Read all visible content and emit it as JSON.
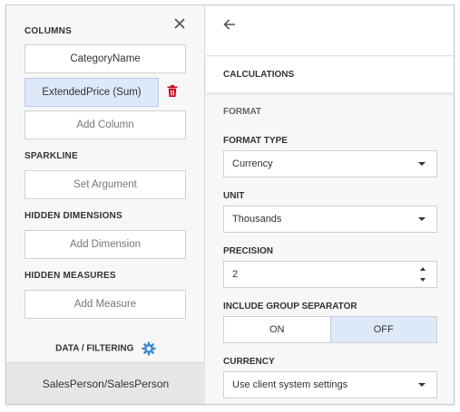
{
  "left": {
    "columns_title": "COLUMNS",
    "columns": [
      "CategoryName",
      "ExtendedPrice (Sum)"
    ],
    "add_column": "Add Column",
    "sparkline_title": "SPARKLINE",
    "set_argument": "Set Argument",
    "hidden_dimensions_title": "HIDDEN DIMENSIONS",
    "add_dimension": "Add Dimension",
    "hidden_measures_title": "HIDDEN MEASURES",
    "add_measure": "Add Measure",
    "data_filtering": "DATA / FILTERING",
    "bottom_item": "SalesPerson/SalesPerson"
  },
  "right": {
    "calculations": "CALCULATIONS",
    "format_heading": "FORMAT",
    "format_type_label": "FORMAT TYPE",
    "format_type_value": "Currency",
    "unit_label": "UNIT",
    "unit_value": "Thousands",
    "precision_label": "PRECISION",
    "precision_value": "2",
    "group_sep_label": "INCLUDE GROUP SEPARATOR",
    "on": "ON",
    "off": "OFF",
    "currency_label": "CURRENCY",
    "currency_value": "Use client system settings"
  },
  "icons": {
    "close": "close-icon",
    "trash": "trash-icon",
    "gear": "gear-icon",
    "back": "arrow-left-icon"
  },
  "colors": {
    "selected_bg": "#dde9f8",
    "trash": "#d0021b",
    "gear": "#3c8ad6"
  }
}
